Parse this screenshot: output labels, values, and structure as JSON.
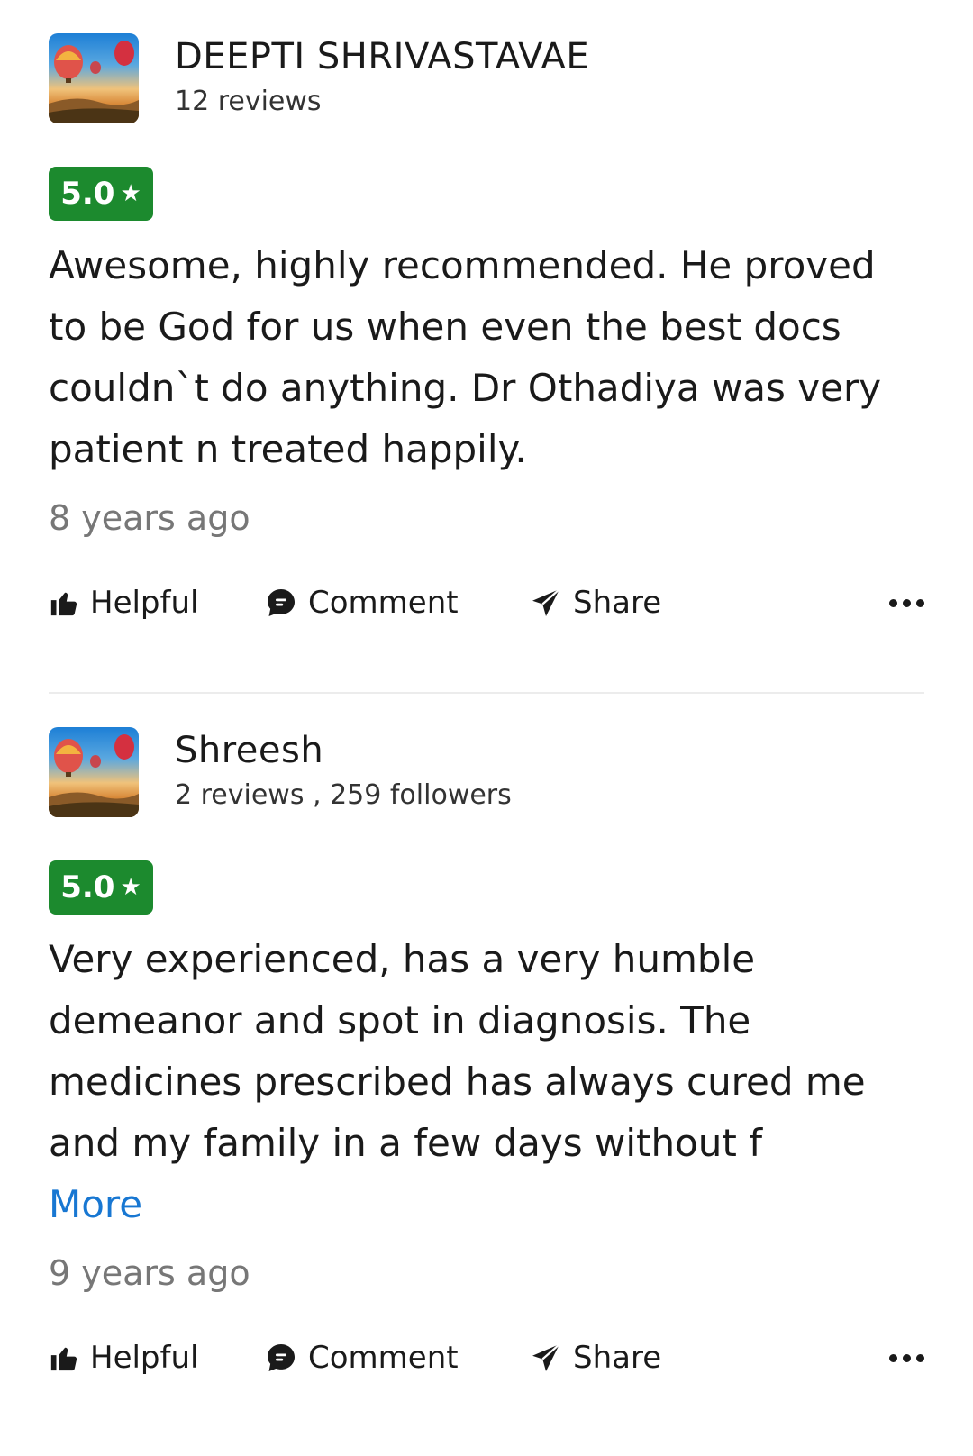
{
  "reviews": [
    {
      "user_name": "DEEPTI SHRIVASTAVAE",
      "user_meta": "12 reviews",
      "rating": "5.0",
      "star_glyph": "★",
      "text": "Awesome, highly recommended. He proved to be God for us when even the best docs couldn`t do anything. Dr Othadiya was very patient n treated happily.",
      "more_label": "",
      "time_ago": "8 years ago",
      "actions": {
        "helpful": "Helpful",
        "comment": "Comment",
        "share": "Share"
      }
    },
    {
      "user_name": "Shreesh",
      "user_meta": "2 reviews , 259 followers",
      "rating": "5.0",
      "star_glyph": "★",
      "text": "Very experienced, has a very humble demeanor and spot in diagnosis. The medicines prescribed has always cured me and my family in a few days without f",
      "more_label": "More",
      "time_ago": "9 years ago",
      "actions": {
        "helpful": "Helpful",
        "comment": "Comment",
        "share": "Share"
      }
    }
  ],
  "colors": {
    "rating_badge": "#1c8a2e",
    "more_link": "#1877d2",
    "time_text": "#777777",
    "divider": "#ececec"
  },
  "icons": {
    "helpful": "thumbs-up-icon",
    "comment": "comment-icon",
    "share": "share-icon",
    "overflow": "more-dots-icon",
    "avatar": "hot-air-balloon-avatar"
  }
}
